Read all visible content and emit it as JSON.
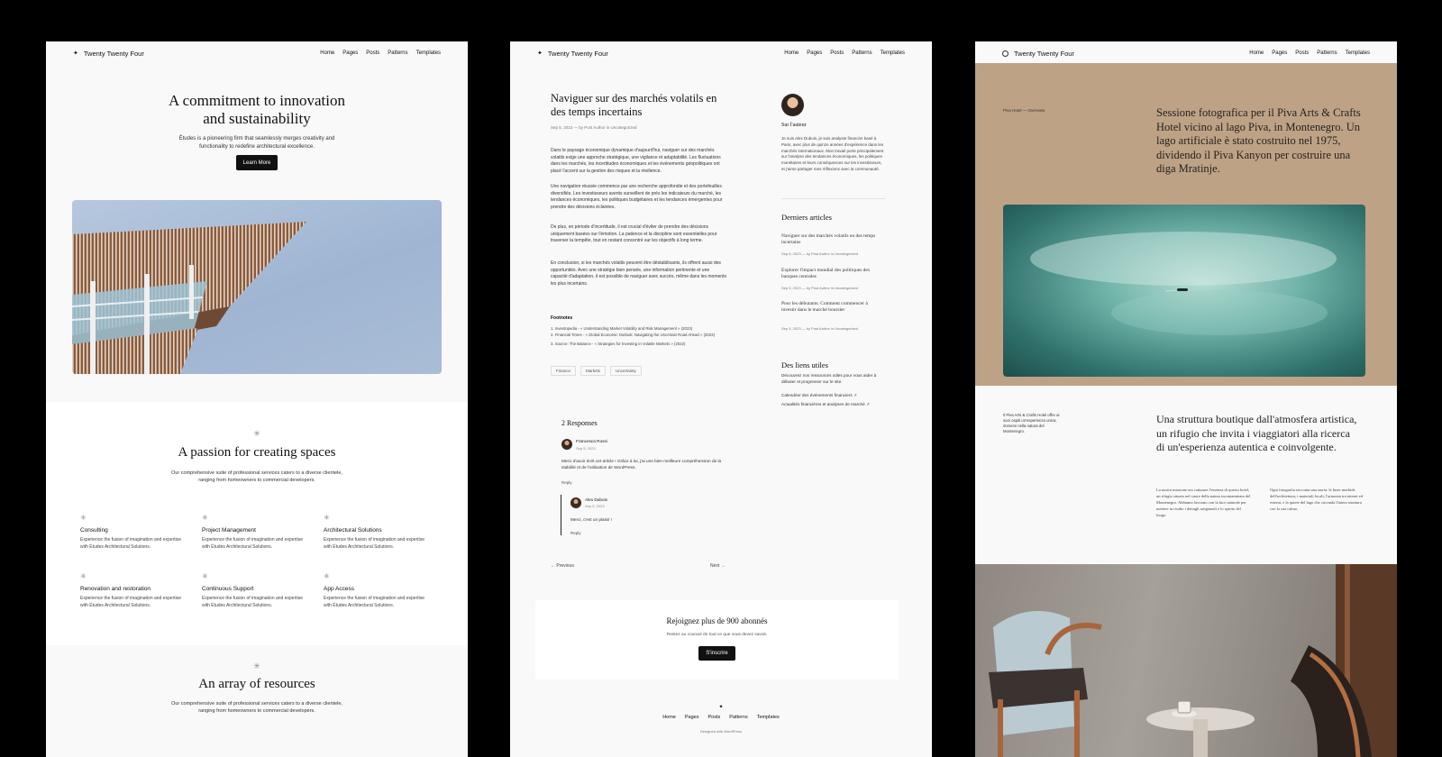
{
  "site": {
    "name": "Twenty Twenty Four",
    "nav": [
      "Home",
      "Pages",
      "Posts",
      "Patterns",
      "Templates"
    ]
  },
  "p1": {
    "hero_title": "A commitment to innovation and sustainability",
    "hero_sub": "Études is a pioneering firm that seamlessly merges creativity and functionality to redefine architectural excellence.",
    "learn_more": "Learn More",
    "sec1_title": "A passion for creating spaces",
    "sec1_sub": "Our comprehensive suite of professional services caters to a diverse clientele, ranging from homeowners to commercial developers.",
    "services": [
      {
        "name": "Consulting",
        "desc": "Experience the fusion of imagination and expertise with Études Architectural Solutions."
      },
      {
        "name": "Project Management",
        "desc": "Experience the fusion of imagination and expertise with Études Architectural Solutions."
      },
      {
        "name": "Architectural Solutions",
        "desc": "Experience the fusion of imagination and expertise with Études Architectural Solutions."
      },
      {
        "name": "Renovation and restoration",
        "desc": "Experience the fusion of imagination and expertise with Études Architectural Solutions."
      },
      {
        "name": "Continuous Support",
        "desc": "Experience the fusion of imagination and expertise with Études Architectural Solutions."
      },
      {
        "name": "App Access",
        "desc": "Experience the fusion of imagination and expertise with Études Architectural Solutions."
      }
    ],
    "sec2_title": "An array of resources",
    "sec2_sub": "Our comprehensive suite of professional services caters to a diverse clientele, ranging from homeowners to commercial developers."
  },
  "p2": {
    "post_title": "Naviguer sur des marchés volatils en des temps incertains",
    "meta": "Sep 5, 2023 — by Post Author in Uncategorized",
    "paras": [
      "Dans le paysage économique dynamique d'aujourd'hui, naviguer sur des marchés volatils exige une approche stratégique, une vigilance et adaptabilité. Les fluctuations dans les marchés, les incertitudes économiques et les événements géopolitiques ont placé l'accent sur la gestion des risques et la résilience.",
      "Une navigation réussie commence par une recherche approfondie et des portefeuilles diversifiés. Les investisseurs avertis surveillent de près les indicateurs du marché, les tendances économiques, les politiques budgétaires et les tendances émergentes pour prendre des décisions éclairées.",
      "De plus, en période d'incertitude, il est crucial d'éviter de prendre des décisions uniquement basées sur l'émotion. La patience et la discipline sont essentielles pour traverser la tempête, tout en restant concentré sur les objectifs à long terme.",
      "En conclusion, si les marchés volatils peuvent être déstabilisants, ils offrent aussi des opportunités. Avec une stratégie bien pensée, une information pertinente et une capacité d'adaptation, il est possible de naviguer avec succès, même dans les moments les plus incertains."
    ],
    "footnotes_label": "Footnotes",
    "footnotes": [
      "1. Investopedia - « Understanding Market Volatility and Risk Management » (2023)",
      "2. Financial Times - « Global Economic Outlook: Navigating the Uncertain Road Ahead » (2023)",
      "3. Source: The Balance - « Strategies for Investing in Volatile Markets » (2022)"
    ],
    "tags": [
      "Finance",
      "Markets",
      "Uncertainty"
    ],
    "responses_title": "2 Responses",
    "comment1": {
      "name": "Francesca Rossi",
      "date": "Sep 5, 2023",
      "text": "Merci d'avoir écrit cet article ! Grâce à lui, j'ai une bien meilleure compréhension de la stabilité et de l'utilisation de WordPress.",
      "reply": "Reply"
    },
    "comment2": {
      "name": "Alex Dubois",
      "date": "Sep 5, 2023",
      "text": "Merci, c'est un plaisir !",
      "reply": "Reply"
    },
    "prev": "← Previous",
    "next": "Next →",
    "about_label": "Sur l'auteur",
    "bio": "Je suis Alex Dubois, je suis analyste financier basé à Paris, avec plus de quinze années d'expérience dans les marchés internationaux. Mon travail porte principalement sur l'analyse des tendances économiques, les politiques monétaires et leurs conséquences sur les investisseurs, et j'aime partager mes réflexions avec la communauté.",
    "recent_title": "Derniers articles",
    "recent": [
      {
        "title": "Naviguer sur des marchés volatils en des temps incertains",
        "meta": "Sep 5, 2023 — by Post Author in Uncategorized"
      },
      {
        "title": "Explorer l'impact mondial des politiques des banques centrales",
        "meta": "Sep 5, 2023 — by Post Author in Uncategorized"
      },
      {
        "title": "Pour les débutants: Comment commencer à investir dans le marché boursier",
        "meta": "Sep 5, 2023 — by Post Author in Uncategorized"
      }
    ],
    "links_title": "Des liens utiles",
    "links": [
      "Découvrez nos ressources utiles pour vous aider à débuter et progresser sur le site.",
      "Calendrier des événements financiers ↗",
      "Actualités financières et analyses de marché ↗"
    ],
    "subscribe_title": "Rejoignez plus de 900 abonnés",
    "subscribe_text": "Restez au courant de tout ce que vous devez savoir.",
    "subscribe_btn": "S'inscrire",
    "credit": "Designed with WordPress"
  },
  "p3": {
    "crumb": "Piva Hotel — Overview",
    "quote": "Sessione fotografica per il Piva Arts & Crafts Hotel vicino al lago Piva, in Montenegro. Un lago artificiale è stato costruito nel 1975, dividendo il Piva Kanyon per costruire una diga Mratinje.",
    "note": "Il Piva Arts & Crafts Hotel offre ai suoi ospiti un'esperienza unica, immersi nella natura del Montenegro.",
    "boutique": "Una struttura boutique dall'atmosfera artistica, un rifugio che invita i viaggiatori alla ricerca di un'esperienza autentica e coinvolgente.",
    "col1": "La nostra missione era catturare l'essenza di questo hotel, un rifugio situato nel cuore della natura incontaminata del Montenegro. Abbiamo lavorato con la luce naturale per mettere in risalto i dettagli artigianali e lo spirito del luogo.",
    "col2": "Ogni fotografia racconta una storia: le linee morbide dell'architettura, i materiali locali, l'armonia tra interni ed esterni, e la quiete del lago che circonda l'intera struttura con la sua calma."
  }
}
